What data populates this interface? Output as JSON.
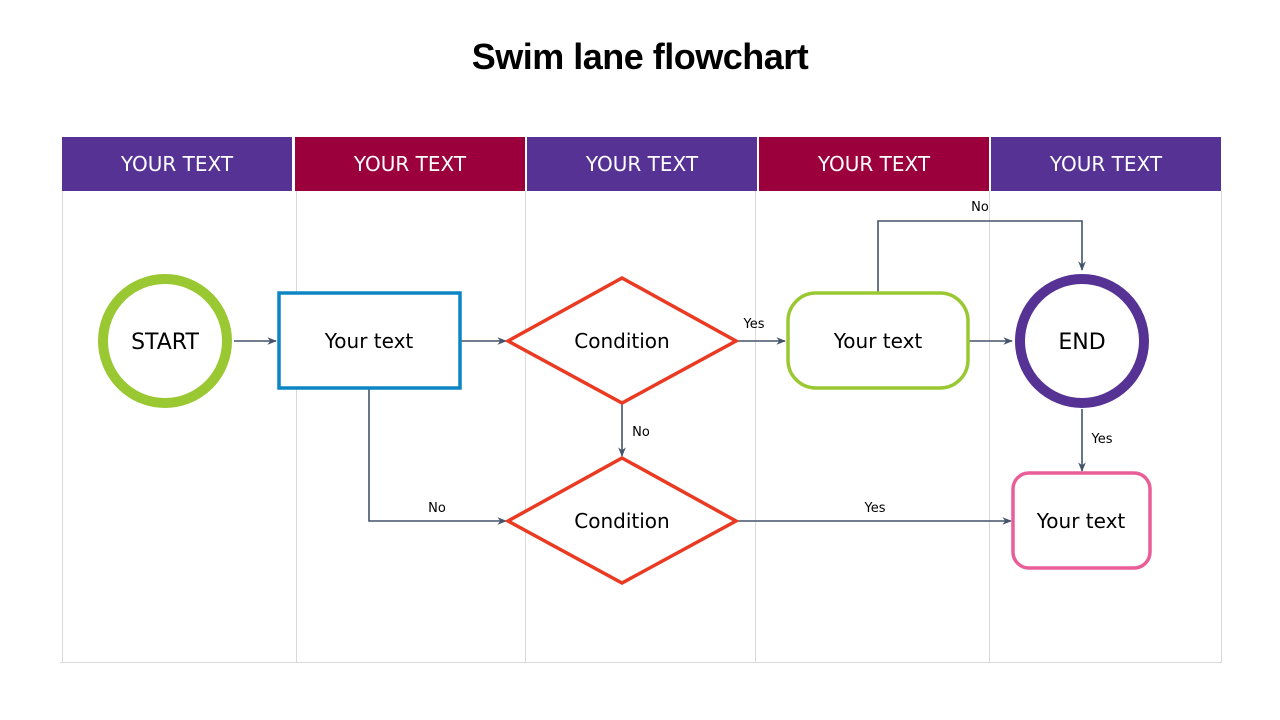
{
  "title": "Swim lane flowchart",
  "colors": {
    "lane_purple": "#563295",
    "lane_crimson": "#9b003c",
    "start_green": "#9ac833",
    "process_blue": "#0c86c3",
    "condition_red": "#ea3a22",
    "end_purple": "#563295",
    "result_pink": "#e95e98",
    "connector": "#44546a",
    "lane_divider": "#d9d9d9"
  },
  "lanes": [
    {
      "label": "YOUR TEXT",
      "color": "#563295"
    },
    {
      "label": "YOUR TEXT",
      "color": "#9b003c"
    },
    {
      "label": "YOUR TEXT",
      "color": "#563295"
    },
    {
      "label": "YOUR TEXT",
      "color": "#9b003c"
    },
    {
      "label": "YOUR TEXT",
      "color": "#563295"
    }
  ],
  "nodes": {
    "start": {
      "label": "START",
      "shape": "circle"
    },
    "process1": {
      "label": "Your text",
      "shape": "rectangle"
    },
    "condition1": {
      "label": "Condition",
      "shape": "diamond"
    },
    "condition2": {
      "label": "Condition",
      "shape": "diamond"
    },
    "process2": {
      "label": "Your text",
      "shape": "rounded-rectangle"
    },
    "end": {
      "label": "END",
      "shape": "circle"
    },
    "process3": {
      "label": "Your text",
      "shape": "rounded-rectangle"
    }
  },
  "edges": [
    {
      "from": "start",
      "to": "process1",
      "label": ""
    },
    {
      "from": "process1",
      "to": "condition1",
      "label": ""
    },
    {
      "from": "condition1",
      "to": "process2",
      "label": "Yes"
    },
    {
      "from": "condition1",
      "to": "condition2",
      "label": "No"
    },
    {
      "from": "process1",
      "to": "condition2",
      "label": "No"
    },
    {
      "from": "process2",
      "to": "end",
      "label": ""
    },
    {
      "from": "process2",
      "to": "end",
      "label": "No"
    },
    {
      "from": "end",
      "to": "process3",
      "label": "Yes"
    },
    {
      "from": "condition2",
      "to": "process3",
      "label": "Yes"
    }
  ]
}
